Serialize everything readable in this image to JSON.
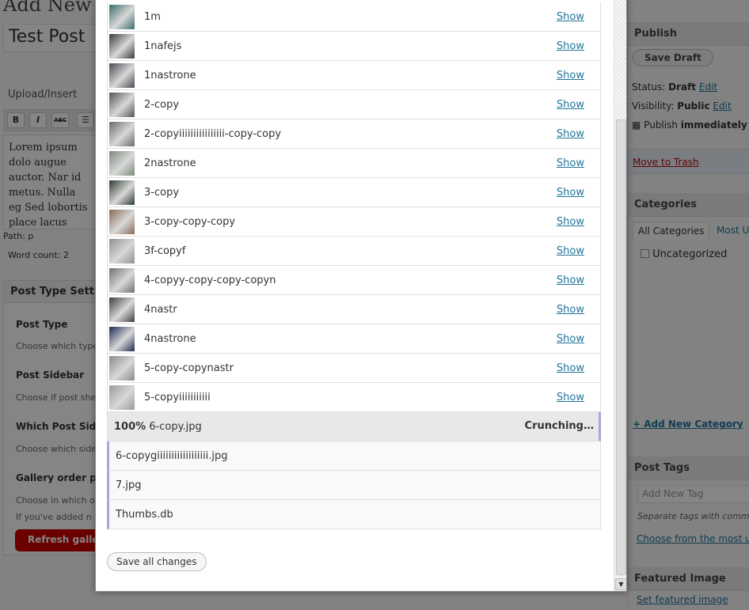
{
  "background": {
    "page_heading": "Add New",
    "post_title": "Test Post",
    "upload_insert": "Upload/Insert",
    "format_buttons": [
      "B",
      "I",
      "ABC",
      "☰"
    ],
    "editor_text": "Lorem ipsum dolo augue auctor. Nar id metus. Nulla eg Sed lobortis place lacus erat ac enim lorem commodo",
    "path": "Path: p",
    "word_count": "Word count: 2",
    "settings_box": {
      "title": "Post Type Setting",
      "post_type_label": "Post Type",
      "post_type_hint": "Choose which type",
      "post_sidebar_label": "Post Sidebar",
      "post_sidebar_hint": "Choose if post she",
      "which_sidebar_label": "Which Post Side",
      "which_sidebar_hint": "Choose which side",
      "gallery_order_label": "Gallery order p",
      "gallery_order_hint1": "Choose in which o",
      "gallery_order_hint2": "If you've added n",
      "refresh_button": "Refresh galle"
    },
    "right_column": {
      "publish_title": "Publish",
      "save_draft": "Save Draft",
      "status_label": "Status:",
      "status_value": "Draft",
      "edit1": "Edit",
      "visibility_label": "Visibility:",
      "visibility_value": "Public",
      "edit2": "Edit",
      "publish_label": "Publish",
      "publish_value": "immediately",
      "move_to_trash": "Move to Trash",
      "categories_title": "Categories",
      "tab_all": "All Categories",
      "tab_most": "Most U",
      "uncategorized": "Uncategorized",
      "add_category": "+ Add New Category",
      "tags_title": "Post Tags",
      "add_tag_placeholder": "Add New Tag",
      "separate_tags": "Separate tags with comm",
      "choose_most_used": "Choose from the most us",
      "featured_title": "Featured Image",
      "set_featured": "Set featured image"
    }
  },
  "modal": {
    "show_label": "Show",
    "uploaded_files": [
      {
        "name": "1m",
        "thumb_color": "#3a6e6a"
      },
      {
        "name": "1nafejs",
        "thumb_color": "#3b3b3b"
      },
      {
        "name": "1nastrone",
        "thumb_color": "#4a4a52"
      },
      {
        "name": "2-copy",
        "thumb_color": "#555555"
      },
      {
        "name": "2-copyiiiiiiiiiiiiiiii-copy-copy",
        "thumb_color": "#6a6a6a"
      },
      {
        "name": "2nastrone",
        "thumb_color": "#7b8a7a"
      },
      {
        "name": "3-copy",
        "thumb_color": "#2c3a2e"
      },
      {
        "name": "3-copy-copy-copy",
        "thumb_color": "#8a6a5a"
      },
      {
        "name": "3f-copyf",
        "thumb_color": "#909090"
      },
      {
        "name": "4-copyy-copy-copy-copyn",
        "thumb_color": "#707070"
      },
      {
        "name": "4nastr",
        "thumb_color": "#3e3e3e"
      },
      {
        "name": "4nastrone",
        "thumb_color": "#1f2a52"
      },
      {
        "name": "5-copy-copynastr",
        "thumb_color": "#8a8a8a"
      },
      {
        "name": "5-copyiiiiiiiiiii",
        "thumb_color": "#9a9a9a"
      }
    ],
    "active_upload": {
      "percent": "100%",
      "filename": "6-copy.jpg",
      "status": "Crunching…"
    },
    "queued_files": [
      "6-copygiiiiiiiiiiiiiiiiii.jpg",
      "7.jpg",
      "Thumbs.db"
    ],
    "save_all_changes": "Save all changes"
  }
}
